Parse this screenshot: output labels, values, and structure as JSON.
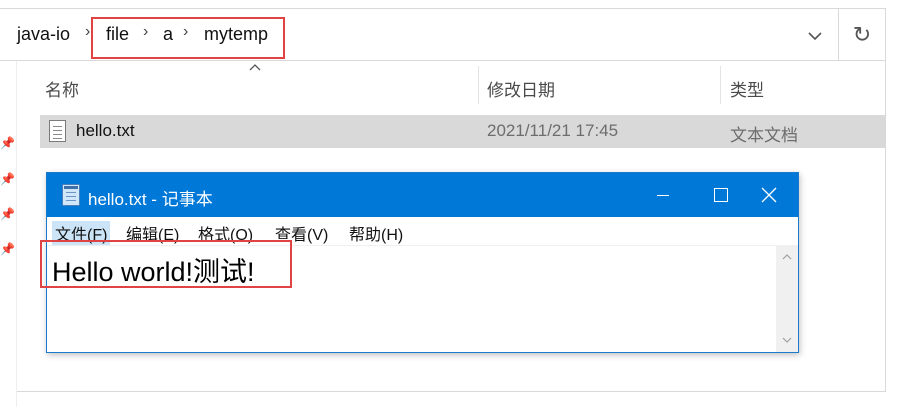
{
  "explorer": {
    "breadcrumbs": [
      "java-io",
      "file",
      "a",
      "mytemp"
    ],
    "breadcrumb_separator": "›",
    "columns": {
      "name": "名称",
      "date_modified": "修改日期",
      "type": "类型"
    },
    "files": [
      {
        "name": "hello.txt",
        "date_modified": "2021/11/21 17:45",
        "type": "文本文档"
      }
    ],
    "icons": {
      "dropdown": "chevron-down-icon",
      "refresh": "refresh-icon",
      "sort": "sort-up-icon",
      "file": "text-file-icon",
      "pin": "pin-icon"
    },
    "highlight_color": "#e04343",
    "selection_color": "#d9d9d9"
  },
  "notepad": {
    "title": "hello.txt - 记事本",
    "menu": [
      "文件(F)",
      "编辑(E)",
      "格式(O)",
      "查看(V)",
      "帮助(H)"
    ],
    "content": "Hello world!测试!",
    "titlebar_color": "#0078d7"
  }
}
